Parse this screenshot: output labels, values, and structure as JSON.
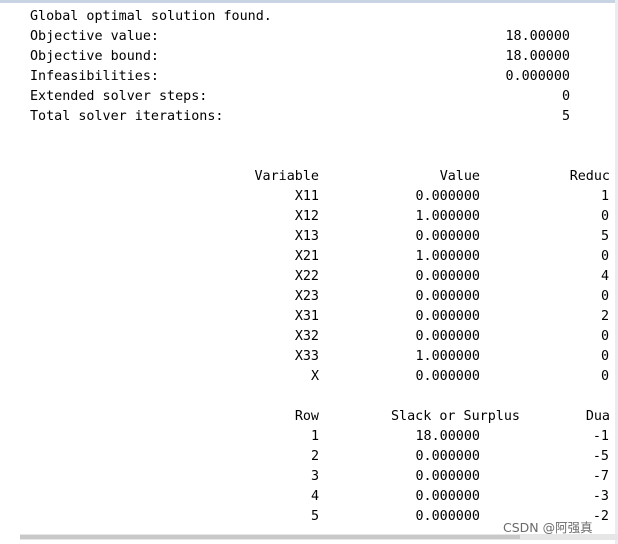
{
  "summary": {
    "status": "Global optimal solution found.",
    "rows": [
      {
        "label": "Objective value:",
        "value": "18.00000"
      },
      {
        "label": "Objective bound:",
        "value": "18.00000"
      },
      {
        "label": "Infeasibilities:",
        "value": "0.000000"
      },
      {
        "label": "Extended solver steps:",
        "value": "0"
      },
      {
        "label": "Total solver iterations:",
        "value": "5"
      }
    ]
  },
  "variables": {
    "headers": {
      "name": "Variable",
      "value": "Value",
      "reduced": "Reduc"
    },
    "rows": [
      {
        "name": "X11",
        "value": "0.000000",
        "reduced": "1"
      },
      {
        "name": "X12",
        "value": "1.000000",
        "reduced": "0"
      },
      {
        "name": "X13",
        "value": "0.000000",
        "reduced": "5"
      },
      {
        "name": "X21",
        "value": "1.000000",
        "reduced": "0"
      },
      {
        "name": "X22",
        "value": "0.000000",
        "reduced": "4"
      },
      {
        "name": "X23",
        "value": "0.000000",
        "reduced": "0"
      },
      {
        "name": "X31",
        "value": "0.000000",
        "reduced": "2"
      },
      {
        "name": "X32",
        "value": "0.000000",
        "reduced": "0"
      },
      {
        "name": "X33",
        "value": "1.000000",
        "reduced": "0"
      },
      {
        "name": "X",
        "value": "0.000000",
        "reduced": "0"
      }
    ]
  },
  "constraints": {
    "headers": {
      "row": "Row",
      "slack": "Slack or Surplus",
      "dual": "Dua"
    },
    "rows": [
      {
        "row": "1",
        "slack": "18.00000",
        "dual": "-1"
      },
      {
        "row": "2",
        "slack": "0.000000",
        "dual": "-5"
      },
      {
        "row": "3",
        "slack": "0.000000",
        "dual": "-7"
      },
      {
        "row": "4",
        "slack": "0.000000",
        "dual": "-3"
      },
      {
        "row": "5",
        "slack": "0.000000",
        "dual": "-2"
      }
    ]
  },
  "watermark": "CSDN @阿强真"
}
